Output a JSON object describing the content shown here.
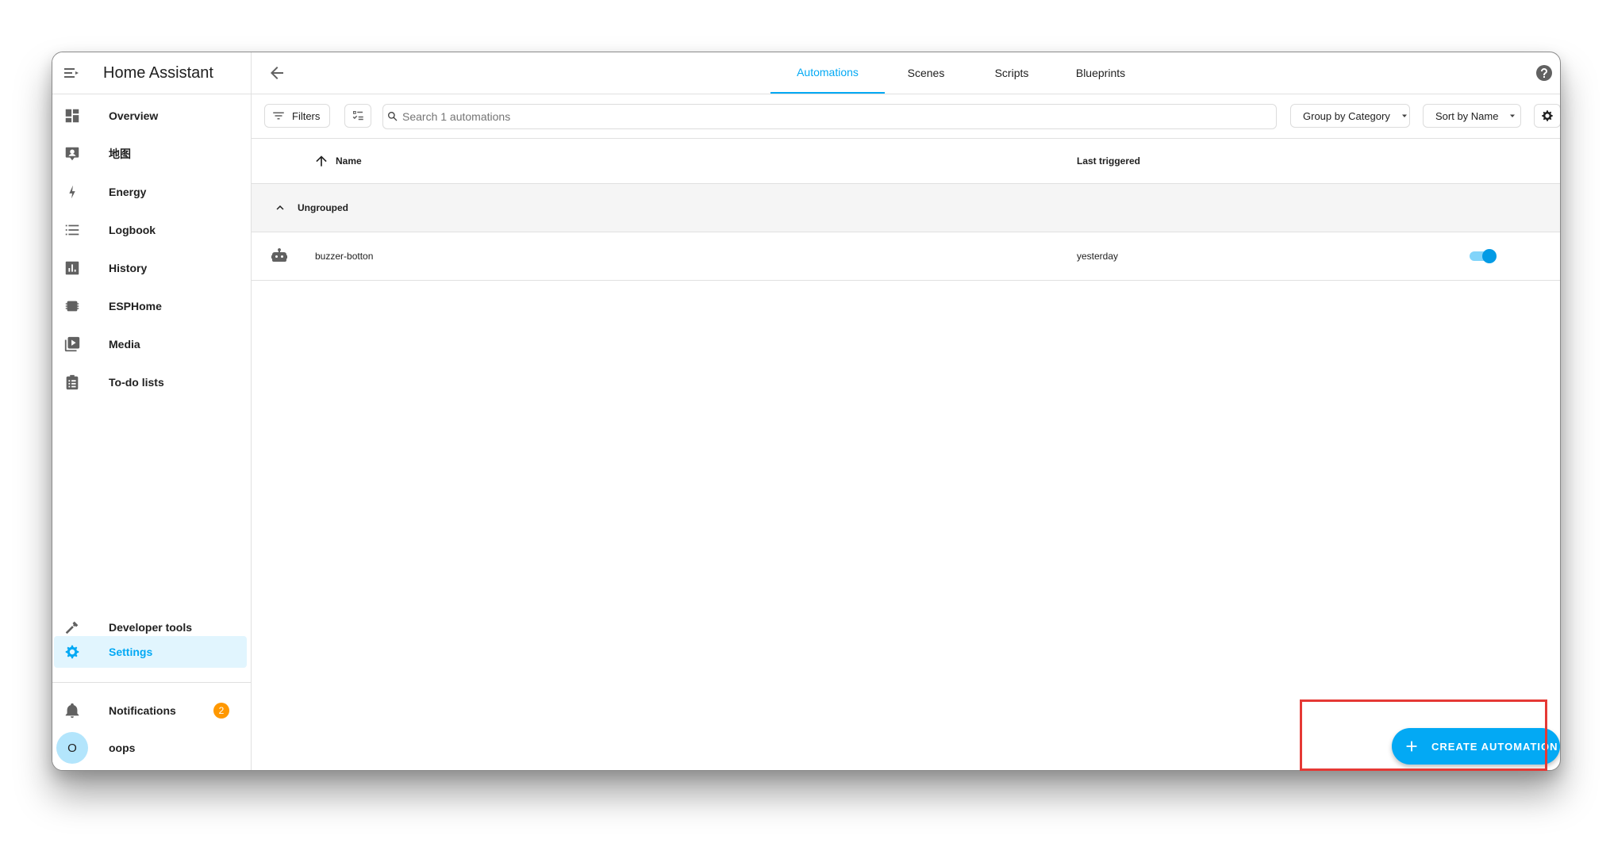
{
  "sidebar": {
    "title": "Home Assistant",
    "items": [
      {
        "label": "Overview",
        "icon": "dashboard-icon"
      },
      {
        "label": "地图",
        "icon": "map-icon"
      },
      {
        "label": "Energy",
        "icon": "lightning-bolt-icon"
      },
      {
        "label": "Logbook",
        "icon": "list-icon"
      },
      {
        "label": "History",
        "icon": "chart-box-icon"
      },
      {
        "label": "ESPHome",
        "icon": "chip-icon"
      },
      {
        "label": "Media",
        "icon": "play-box-icon"
      },
      {
        "label": "To-do lists",
        "icon": "clipboard-list-icon"
      }
    ],
    "bottom_items": [
      {
        "label": "Developer tools",
        "icon": "hammer-icon"
      },
      {
        "label": "Settings",
        "icon": "cog-icon",
        "active": true
      }
    ],
    "notifications": {
      "label": "Notifications",
      "count": "2"
    },
    "user": {
      "initial": "O",
      "name": "oops"
    }
  },
  "tabs": [
    {
      "label": "Automations",
      "active": true
    },
    {
      "label": "Scenes"
    },
    {
      "label": "Scripts"
    },
    {
      "label": "Blueprints"
    }
  ],
  "toolbar": {
    "filters_label": "Filters",
    "search_placeholder": "Search 1 automations",
    "group_by_label": "Group by Category",
    "sort_by_label": "Sort by Name"
  },
  "table": {
    "columns": {
      "name": "Name",
      "last_triggered": "Last triggered"
    },
    "group_label": "Ungrouped",
    "rows": [
      {
        "name": "buzzer-botton",
        "last_triggered": "yesterday",
        "enabled": true
      }
    ]
  },
  "fab_label": "CREATE AUTOMATION",
  "colors": {
    "accent": "#03a9f4",
    "active_bg": "#e1f5fe",
    "badge": "#ff9800",
    "highlight": "#e53935"
  }
}
